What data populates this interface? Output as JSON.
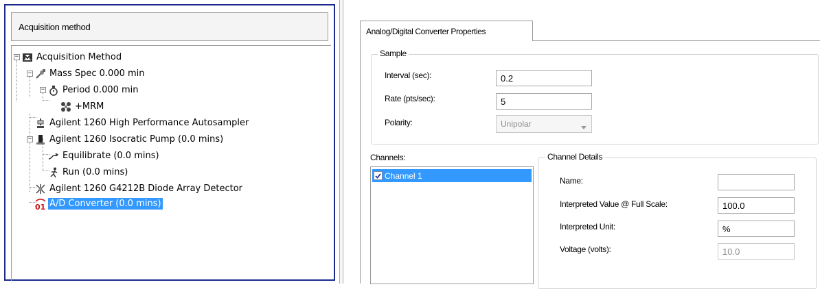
{
  "left_panel": {
    "header": "Acquisition method",
    "tree": [
      {
        "label": "Acquisition Method",
        "icon": "method-icon"
      },
      {
        "label": "Mass Spec  0.000 min",
        "icon": "mass-spec-icon"
      },
      {
        "label": "Period  0.000 min",
        "icon": "period-icon"
      },
      {
        "label": "+MRM",
        "icon": "mrm-icon"
      },
      {
        "label": "Agilent 1260 High Performance Autosampler",
        "icon": "autosampler-icon"
      },
      {
        "label": "Agilent 1260 Isocratic Pump (0.0 mins)",
        "icon": "pump-icon"
      },
      {
        "label": "Equilibrate (0.0 mins)",
        "icon": "equilibrate-icon"
      },
      {
        "label": "Run (0.0 mins)",
        "icon": "run-icon"
      },
      {
        "label": "Agilent 1260 G4212B Diode Array Detector",
        "icon": "detector-icon"
      },
      {
        "label": "A/D Converter (0.0 mins)",
        "icon": "ad-converter-icon"
      }
    ],
    "selected_item": "A/D Converter (0.0 mins)"
  },
  "right_panel": {
    "tab_title": "Analog/Digital Converter Properties",
    "sample": {
      "legend": "Sample",
      "interval_label": "Interval (sec):",
      "interval_value": "0.2",
      "rate_label": "Rate (pts/sec):",
      "rate_value": "5",
      "polarity_label": "Polarity:",
      "polarity_value": "Unipolar"
    },
    "channels": {
      "label": "Channels:",
      "items": [
        {
          "label": "Channel 1",
          "checked": true
        }
      ]
    },
    "channel_details": {
      "legend": "Channel Details",
      "name_label": "Name:",
      "name_value": "",
      "full_scale_label": "Interpreted Value @ Full Scale:",
      "full_scale_value": "100.0",
      "unit_label": "Interpreted Unit:",
      "unit_value": "%",
      "voltage_label": "Voltage (volts):",
      "voltage_value": "10.0"
    }
  },
  "colors": {
    "selection": "#3399ff",
    "panel_border": "#1a2a8a",
    "ad_icon_red": "#cc1111"
  }
}
